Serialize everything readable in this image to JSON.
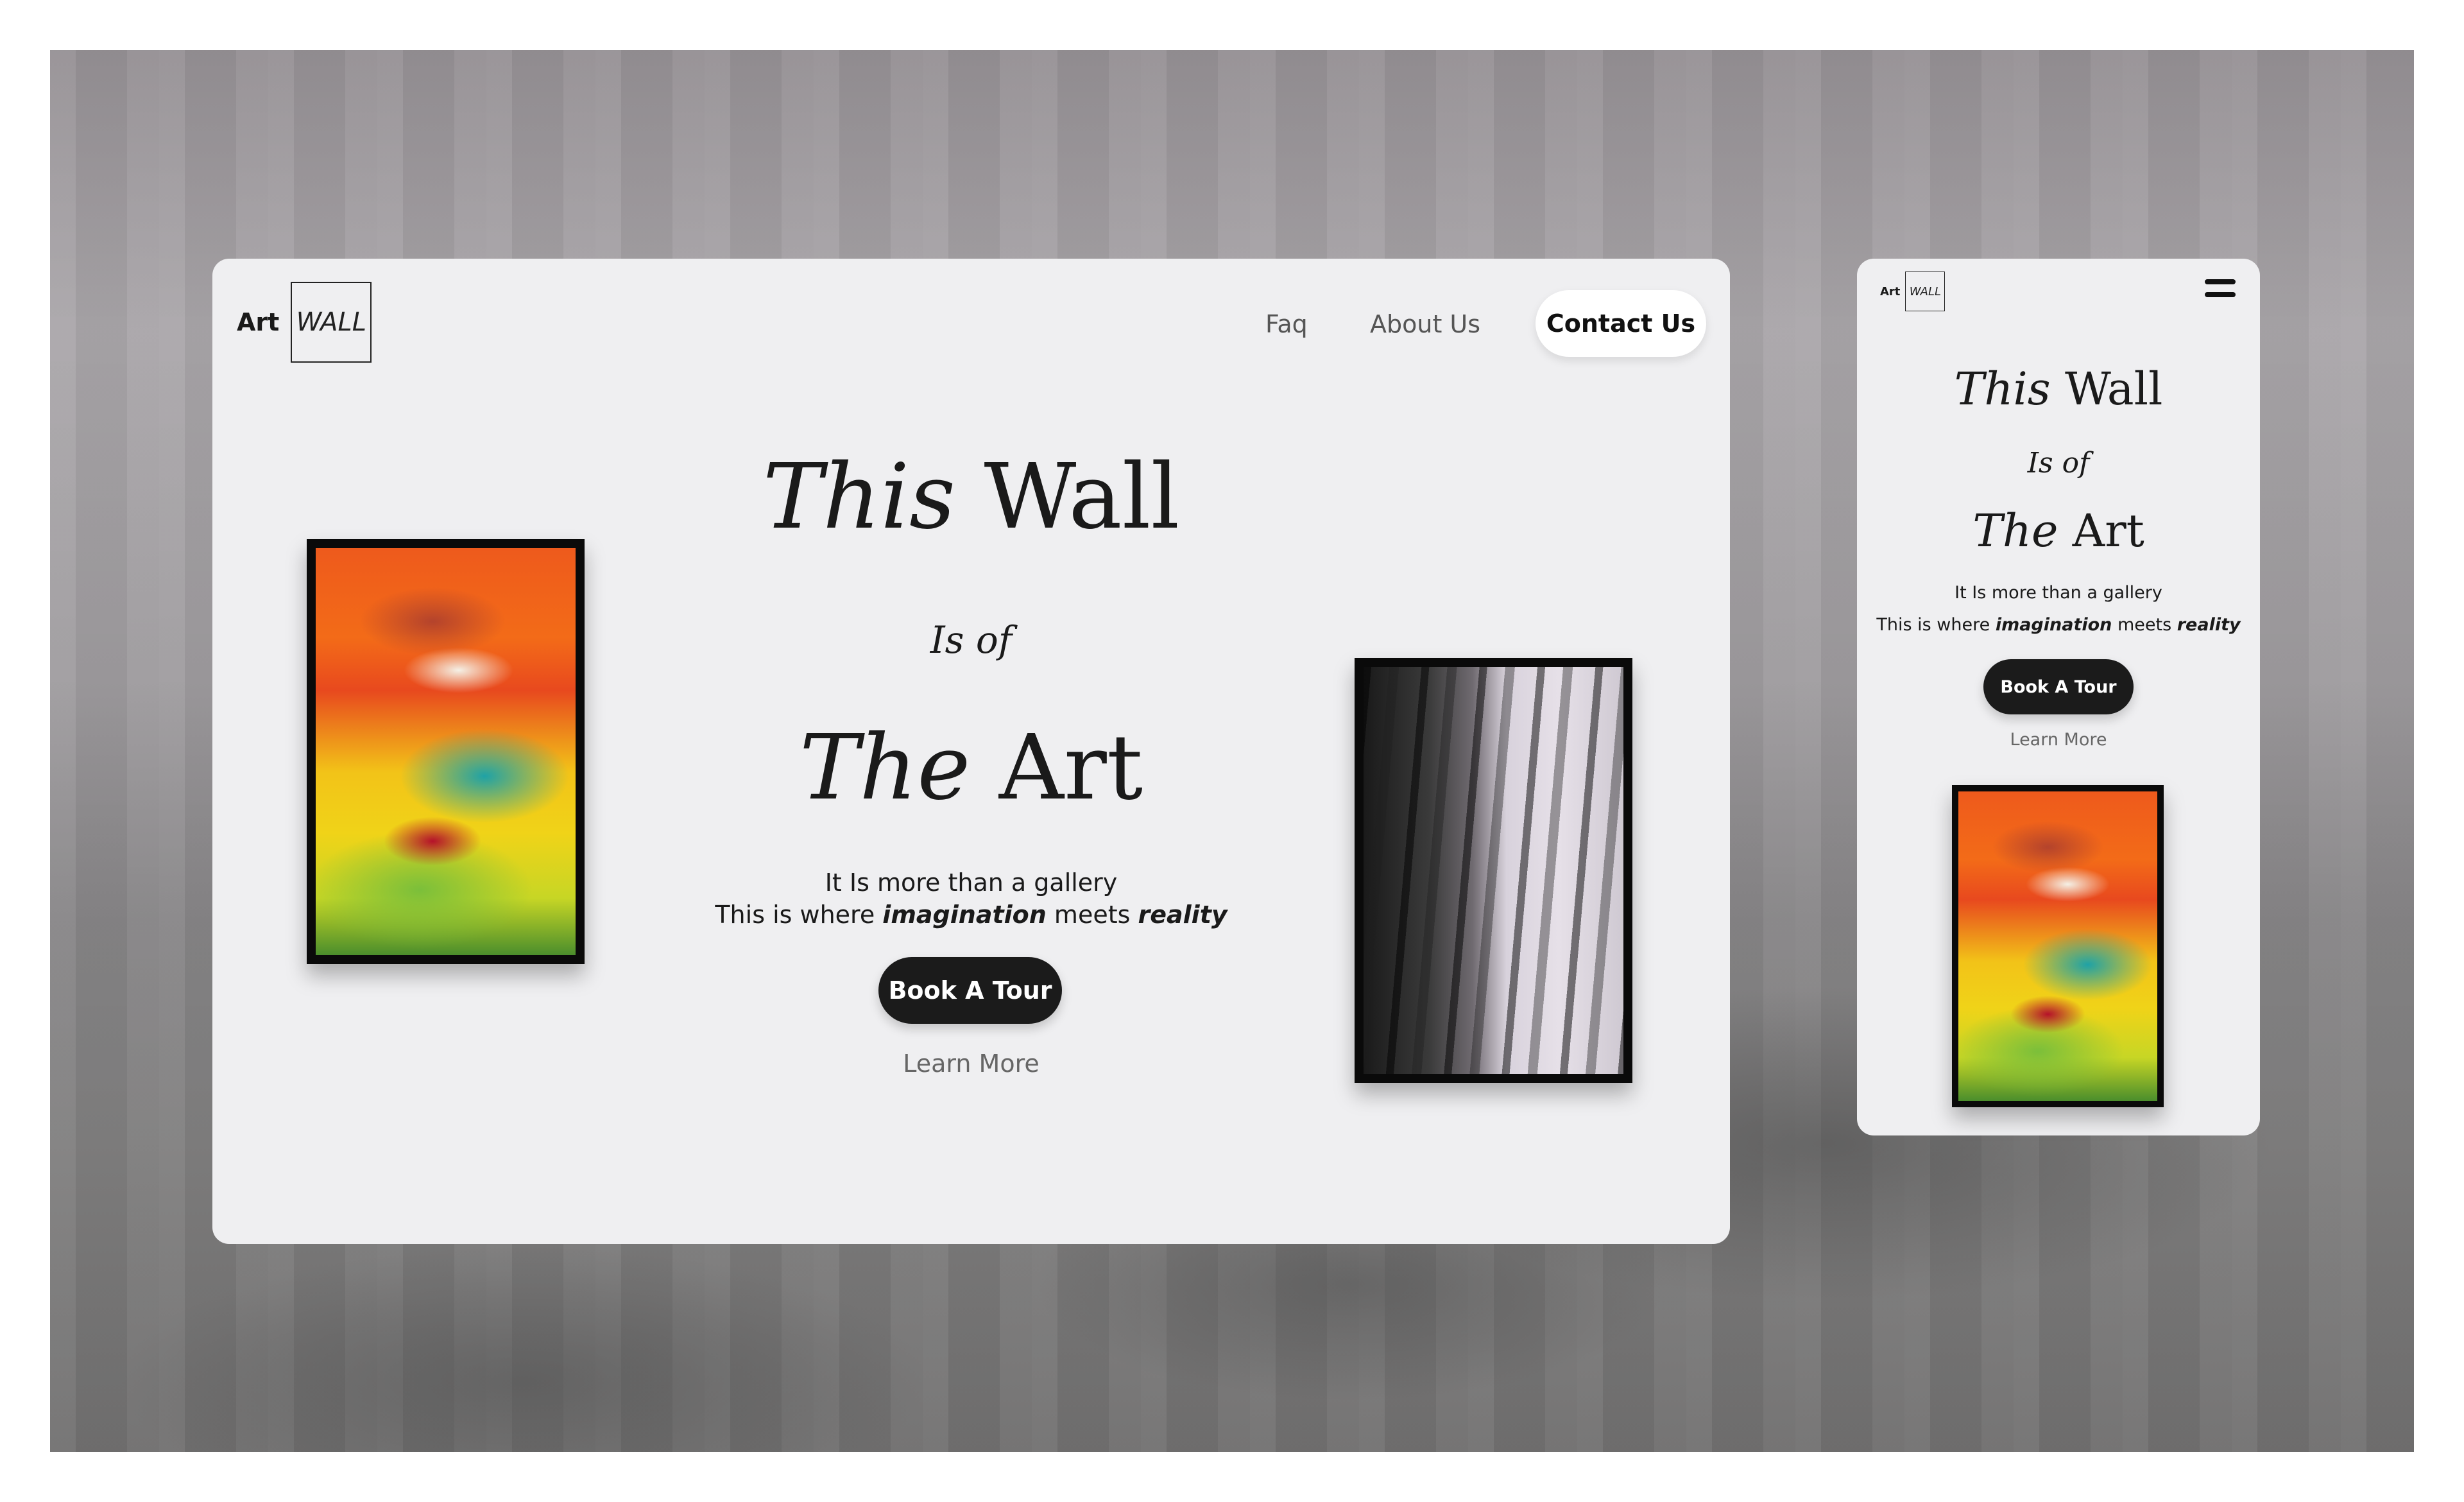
{
  "brand": {
    "art": "Art",
    "wall": "WALL"
  },
  "nav": {
    "faq": "Faq",
    "about": "About Us",
    "contact": "Contact Us"
  },
  "hero": {
    "line1_italic": "This",
    "line1_rest": " Wall",
    "line2": "Is of",
    "line3_italic": "The",
    "line3_rest": " Art",
    "sub1": "It Is more than a gallery",
    "sub2_a": "This is where ",
    "sub2_em1": "imagination",
    "sub2_b": " meets ",
    "sub2_em2": "reality",
    "book": "Book A Tour",
    "learn": "Learn More"
  },
  "icons": {
    "menu": "hamburger-menu-icon"
  },
  "colors": {
    "card_bg": "#efeff1",
    "button_dark": "#1b1b1b",
    "contact_bg": "#ffffff"
  }
}
